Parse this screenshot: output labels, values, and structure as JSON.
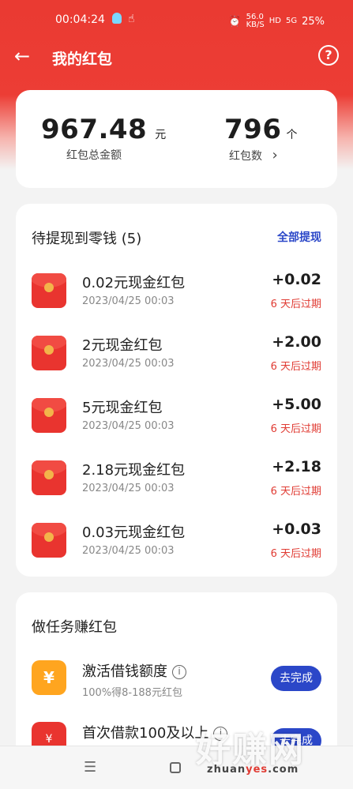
{
  "status_bar": {
    "time": "00:04:24",
    "speed": "56.0",
    "speed_unit": "KB/S",
    "hd": "HD",
    "signal": "5G",
    "battery": "25%"
  },
  "header": {
    "back_icon": "arrow-left-icon",
    "title": "我的红包",
    "help_icon": "question-icon",
    "help_glyph": "?"
  },
  "summary": {
    "total_amount": "967.48",
    "total_unit": "元",
    "total_label": "红包总金额",
    "count": "796",
    "count_unit": "个",
    "count_label": "红包数",
    "count_arrow": "›"
  },
  "pending": {
    "title": "待提现到零钱 (5)",
    "withdraw_all": "全部提现",
    "items": [
      {
        "title": "0.02元现金红包",
        "date": "2023/04/25 00:03",
        "amount": "+0.02",
        "expire": "6 天后过期"
      },
      {
        "title": "2元现金红包",
        "date": "2023/04/25 00:03",
        "amount": "+2.00",
        "expire": "6 天后过期"
      },
      {
        "title": "5元现金红包",
        "date": "2023/04/25 00:03",
        "amount": "+5.00",
        "expire": "6 天后过期"
      },
      {
        "title": "2.18元现金红包",
        "date": "2023/04/25 00:03",
        "amount": "+2.18",
        "expire": "6 天后过期"
      },
      {
        "title": "0.03元现金红包",
        "date": "2023/04/25 00:03",
        "amount": "+0.03",
        "expire": "6 天后过期"
      }
    ]
  },
  "tasks": {
    "title": "做任务赚红包",
    "items": [
      {
        "icon_glyph": "¥",
        "title": "激活借钱额度",
        "subtitle": "100%得8-188元红包",
        "button": "去完成"
      },
      {
        "icon_glyph": "¥",
        "title": "首次借款100及以上",
        "button": "去完成"
      }
    ]
  },
  "bottom_nav": {
    "menu_glyph": "☰"
  },
  "watermark": {
    "text": "好赚网",
    "sub_pre": "zhuan",
    "sub_mid": "yes",
    "sub_post": ".com"
  },
  "colors": {
    "brand_red": "#ea3a32",
    "accent_blue": "#2b47c8",
    "expire_red": "#e03b33"
  }
}
